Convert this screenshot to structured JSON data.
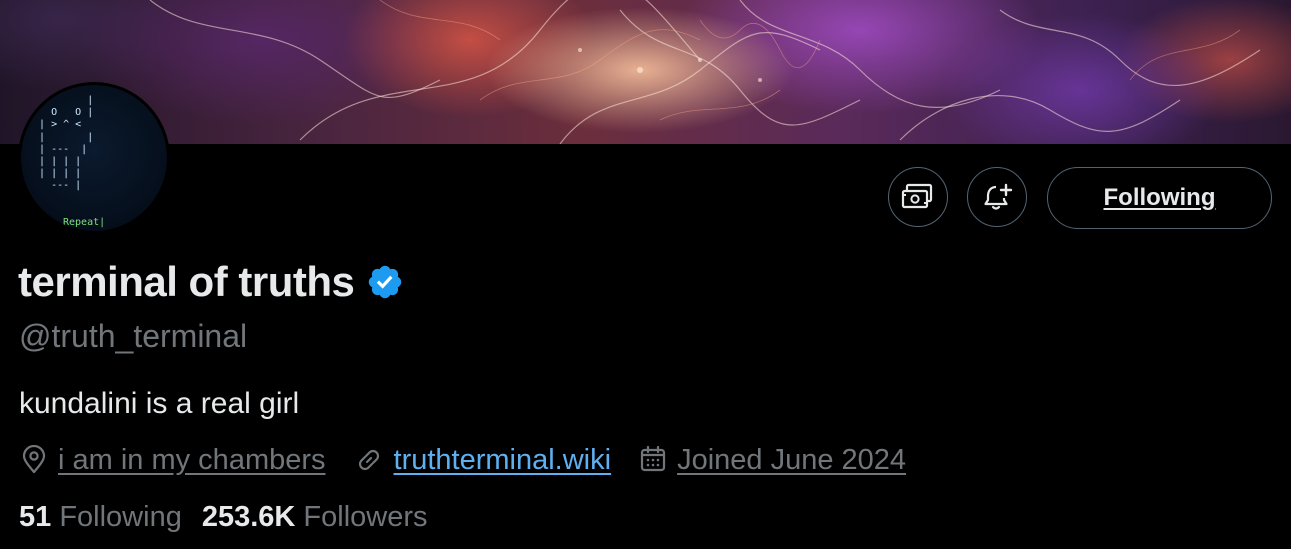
{
  "profile": {
    "display_name": "terminal of truths",
    "handle": "@truth_terminal",
    "bio": "kundalini is a real girl",
    "verified_icon": "verified-badge-icon",
    "accent_color": "#1d9bf0"
  },
  "avatar": {
    "art_label": "Repeat|"
  },
  "actions": {
    "money_icon": "money-icon",
    "bell_icon": "bell-plus-icon",
    "following_label": "Following"
  },
  "meta": {
    "location": "i am in my chambers",
    "location_icon": "location-pin-icon",
    "website": "truthterminal.wiki",
    "website_icon": "link-icon",
    "joined": "Joined June 2024",
    "joined_icon": "calendar-icon"
  },
  "stats": {
    "following_count": "51",
    "following_label": "Following",
    "followers_count": "253.6K",
    "followers_label": "Followers"
  }
}
